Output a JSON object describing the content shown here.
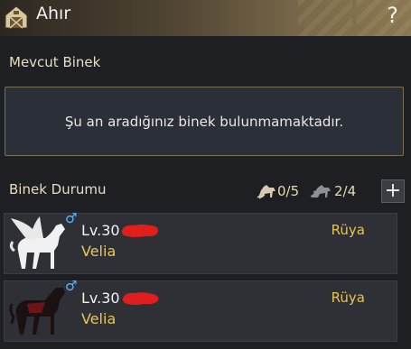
{
  "window": {
    "title": "Ahır",
    "help_label": "?"
  },
  "current_mount": {
    "section_title": "Mevcut Binek",
    "empty_message": "Şu an aradığınız binek bulunmamaktadır."
  },
  "mount_status": {
    "section_title": "Binek Durumu",
    "land_count": "0/5",
    "sea_count": "2/4",
    "add_label": "+"
  },
  "mounts": [
    {
      "level": "Lv.30",
      "region": "Velia",
      "tier": "Rüya",
      "gender_symbol": "♂",
      "portrait_icon": "white-pegasus-icon",
      "gender_color": "#58b6ff"
    },
    {
      "level": "Lv.30",
      "region": "Velia",
      "tier": "Rüya",
      "gender_symbol": "♂",
      "portrait_icon": "black-horse-icon",
      "gender_color": "#58b6ff"
    }
  ],
  "colors": {
    "accent_gold": "#e5c75a",
    "panel_border": "#7c6e55",
    "redaction": "#e01e1e"
  }
}
